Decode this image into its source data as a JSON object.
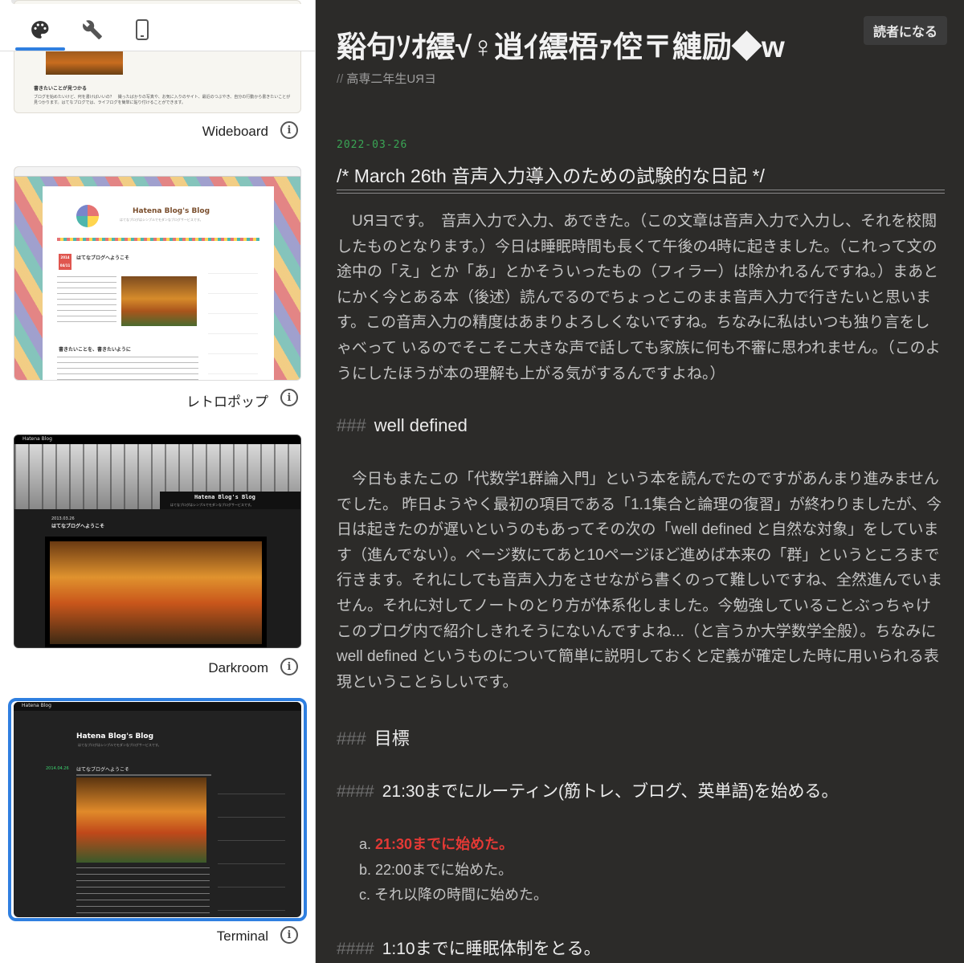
{
  "theme_panel": {
    "tabs": [
      {
        "icon": "palette-icon"
      },
      {
        "icon": "wrench-icon"
      },
      {
        "icon": "smartphone-icon"
      }
    ],
    "themes": [
      {
        "name": "Wideboard",
        "selected": false
      },
      {
        "name": "レトロポップ",
        "selected": false
      },
      {
        "name": "Darkroom",
        "selected": false
      },
      {
        "name": "Terminal",
        "selected": true
      }
    ],
    "wideboard_preview": {
      "heading": "書きたいことが見つかる",
      "text": "ブログを始めたいけど、何を書けばいいの？　撮ったばかりの写真や、お気に入りのサイト、最近のつぶやき、自分の行動から書きたいことが見つかります。はてなブログでは、ライフログを簡単に貼り付けることができます。"
    },
    "retro_preview": {
      "blog_title": "Hatena Blog's Blog",
      "subtitle": "はてなブログはシンプルでモダンなブログサービスです。",
      "date": "2014 04/11",
      "post_title": "はてなブログへようこそ",
      "heading": "書きたいことを、書きたいように"
    },
    "darkroom_preview": {
      "brand": "Hatena Blog",
      "blog_title": "Hatena Blog's Blog",
      "subtitle": "はてなブログはシンプルでモダンなブログサービスです。",
      "date": "2013.03.26",
      "post_title": "はてなブログへようこそ"
    },
    "terminal_preview": {
      "brand": "Hatena Blog",
      "blog_title": "Hatena Blog's Blog",
      "subtitle": "はてなブログはシンプルでモダンなブログサービスです。",
      "date": "2014.04.26",
      "post_title": "はてなブログへようこそ"
    }
  },
  "blog": {
    "title": "谿句ｿｵ繧√♀逍ｲ繧梧ｧ倥〒縺励◆w",
    "description": "高専二年生UЯヨ",
    "read_button": "読者になる",
    "post": {
      "date": "2022-03-26",
      "title": "/*  March 26th 音声入力導入のための試験的な日記   */",
      "para1": "　UЯヨです。　音声入力で入力、あできた。（この文章は音声入力で入力し、それを校閲したものとなります。）今日は睡眠時間も長くて午後の4時に起きました。（これって文の途中の「え」とか「あ」とかそういったもの（フィラー）は除かれるんですね。）まあとにかく今とある本（後述）読んでるのでちょっとこのまま音声入力で行きたいと思います。この音声入力の精度はあまりよろしくないですね。ちなみに私はいつも独り言をしゃべって いるのでそこそこ大きな声で話しても家族に何も不審に思われません。（このようにしたほうが本の理解も上がる気がするんですよね。）",
      "h_well_hash": "###",
      "h_well": "well defined",
      "para2": "　今日もまたこの「代数学1群論入門」という本を読んでたのですがあんまり進みませんでした。 昨日ようやく最初の項目である「1.1集合と論理の復習」が終わりましたが、今日は起きたのが遅いというのもあってその次の「well defined と自然な対象」をしています（進んでない）。ページ数にてあと10ページほど進めば本来の「群」というところまで行きます。それにしても音声入力をさせながら書くのって難しいですね、全然進んでいません。それに対してノートのとり方が体系化しました。今勉強していることぶっちゃけこのブログ内で紹介しきれそうにないんですよね...（と言うか大学数学全般）。ちなみに well defined というものについて簡単に説明しておくと定義が確定した時に用いられる表現ということらしいです。",
      "h_goal_hash": "###",
      "h_goal": "目標",
      "h_routine_hash": "####",
      "h_routine": "21:30までにルーティン(筋トレ、ブログ、英単語)を始める。",
      "list": [
        {
          "marker": "a.",
          "text": "21:30までに始めた。",
          "highlight": true
        },
        {
          "marker": "b.",
          "text": "22:00までに始めた。",
          "highlight": false
        },
        {
          "marker": "c.",
          "text": "それ以降の時間に始めた。",
          "highlight": false
        }
      ],
      "h_sleep_hash": "####",
      "h_sleep": "1:10までに睡眠体制をとる。"
    }
  },
  "colors": {
    "accent_blue": "#2f7fe0",
    "date_green": "#3aa655",
    "highlight_red": "#e53935",
    "dark_bg": "#2c2b29"
  }
}
